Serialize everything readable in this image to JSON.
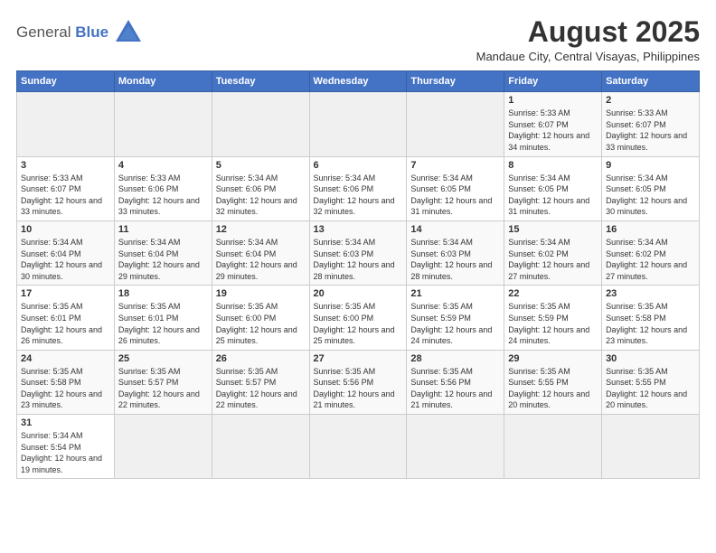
{
  "logo": {
    "text_general": "General",
    "text_blue": "Blue"
  },
  "title": {
    "month_year": "August 2025",
    "location": "Mandaue City, Central Visayas, Philippines"
  },
  "days_of_week": [
    "Sunday",
    "Monday",
    "Tuesday",
    "Wednesday",
    "Thursday",
    "Friday",
    "Saturday"
  ],
  "weeks": [
    [
      {
        "day": "",
        "info": ""
      },
      {
        "day": "",
        "info": ""
      },
      {
        "day": "",
        "info": ""
      },
      {
        "day": "",
        "info": ""
      },
      {
        "day": "",
        "info": ""
      },
      {
        "day": "1",
        "info": "Sunrise: 5:33 AM\nSunset: 6:07 PM\nDaylight: 12 hours and 34 minutes."
      },
      {
        "day": "2",
        "info": "Sunrise: 5:33 AM\nSunset: 6:07 PM\nDaylight: 12 hours and 33 minutes."
      }
    ],
    [
      {
        "day": "3",
        "info": "Sunrise: 5:33 AM\nSunset: 6:07 PM\nDaylight: 12 hours and 33 minutes."
      },
      {
        "day": "4",
        "info": "Sunrise: 5:33 AM\nSunset: 6:06 PM\nDaylight: 12 hours and 33 minutes."
      },
      {
        "day": "5",
        "info": "Sunrise: 5:34 AM\nSunset: 6:06 PM\nDaylight: 12 hours and 32 minutes."
      },
      {
        "day": "6",
        "info": "Sunrise: 5:34 AM\nSunset: 6:06 PM\nDaylight: 12 hours and 32 minutes."
      },
      {
        "day": "7",
        "info": "Sunrise: 5:34 AM\nSunset: 6:05 PM\nDaylight: 12 hours and 31 minutes."
      },
      {
        "day": "8",
        "info": "Sunrise: 5:34 AM\nSunset: 6:05 PM\nDaylight: 12 hours and 31 minutes."
      },
      {
        "day": "9",
        "info": "Sunrise: 5:34 AM\nSunset: 6:05 PM\nDaylight: 12 hours and 30 minutes."
      }
    ],
    [
      {
        "day": "10",
        "info": "Sunrise: 5:34 AM\nSunset: 6:04 PM\nDaylight: 12 hours and 30 minutes."
      },
      {
        "day": "11",
        "info": "Sunrise: 5:34 AM\nSunset: 6:04 PM\nDaylight: 12 hours and 29 minutes."
      },
      {
        "day": "12",
        "info": "Sunrise: 5:34 AM\nSunset: 6:04 PM\nDaylight: 12 hours and 29 minutes."
      },
      {
        "day": "13",
        "info": "Sunrise: 5:34 AM\nSunset: 6:03 PM\nDaylight: 12 hours and 28 minutes."
      },
      {
        "day": "14",
        "info": "Sunrise: 5:34 AM\nSunset: 6:03 PM\nDaylight: 12 hours and 28 minutes."
      },
      {
        "day": "15",
        "info": "Sunrise: 5:34 AM\nSunset: 6:02 PM\nDaylight: 12 hours and 27 minutes."
      },
      {
        "day": "16",
        "info": "Sunrise: 5:34 AM\nSunset: 6:02 PM\nDaylight: 12 hours and 27 minutes."
      }
    ],
    [
      {
        "day": "17",
        "info": "Sunrise: 5:35 AM\nSunset: 6:01 PM\nDaylight: 12 hours and 26 minutes."
      },
      {
        "day": "18",
        "info": "Sunrise: 5:35 AM\nSunset: 6:01 PM\nDaylight: 12 hours and 26 minutes."
      },
      {
        "day": "19",
        "info": "Sunrise: 5:35 AM\nSunset: 6:00 PM\nDaylight: 12 hours and 25 minutes."
      },
      {
        "day": "20",
        "info": "Sunrise: 5:35 AM\nSunset: 6:00 PM\nDaylight: 12 hours and 25 minutes."
      },
      {
        "day": "21",
        "info": "Sunrise: 5:35 AM\nSunset: 5:59 PM\nDaylight: 12 hours and 24 minutes."
      },
      {
        "day": "22",
        "info": "Sunrise: 5:35 AM\nSunset: 5:59 PM\nDaylight: 12 hours and 24 minutes."
      },
      {
        "day": "23",
        "info": "Sunrise: 5:35 AM\nSunset: 5:58 PM\nDaylight: 12 hours and 23 minutes."
      }
    ],
    [
      {
        "day": "24",
        "info": "Sunrise: 5:35 AM\nSunset: 5:58 PM\nDaylight: 12 hours and 23 minutes."
      },
      {
        "day": "25",
        "info": "Sunrise: 5:35 AM\nSunset: 5:57 PM\nDaylight: 12 hours and 22 minutes."
      },
      {
        "day": "26",
        "info": "Sunrise: 5:35 AM\nSunset: 5:57 PM\nDaylight: 12 hours and 22 minutes."
      },
      {
        "day": "27",
        "info": "Sunrise: 5:35 AM\nSunset: 5:56 PM\nDaylight: 12 hours and 21 minutes."
      },
      {
        "day": "28",
        "info": "Sunrise: 5:35 AM\nSunset: 5:56 PM\nDaylight: 12 hours and 21 minutes."
      },
      {
        "day": "29",
        "info": "Sunrise: 5:35 AM\nSunset: 5:55 PM\nDaylight: 12 hours and 20 minutes."
      },
      {
        "day": "30",
        "info": "Sunrise: 5:35 AM\nSunset: 5:55 PM\nDaylight: 12 hours and 20 minutes."
      }
    ],
    [
      {
        "day": "31",
        "info": "Sunrise: 5:34 AM\nSunset: 5:54 PM\nDaylight: 12 hours and 19 minutes."
      },
      {
        "day": "",
        "info": ""
      },
      {
        "day": "",
        "info": ""
      },
      {
        "day": "",
        "info": ""
      },
      {
        "day": "",
        "info": ""
      },
      {
        "day": "",
        "info": ""
      },
      {
        "day": "",
        "info": ""
      }
    ]
  ]
}
